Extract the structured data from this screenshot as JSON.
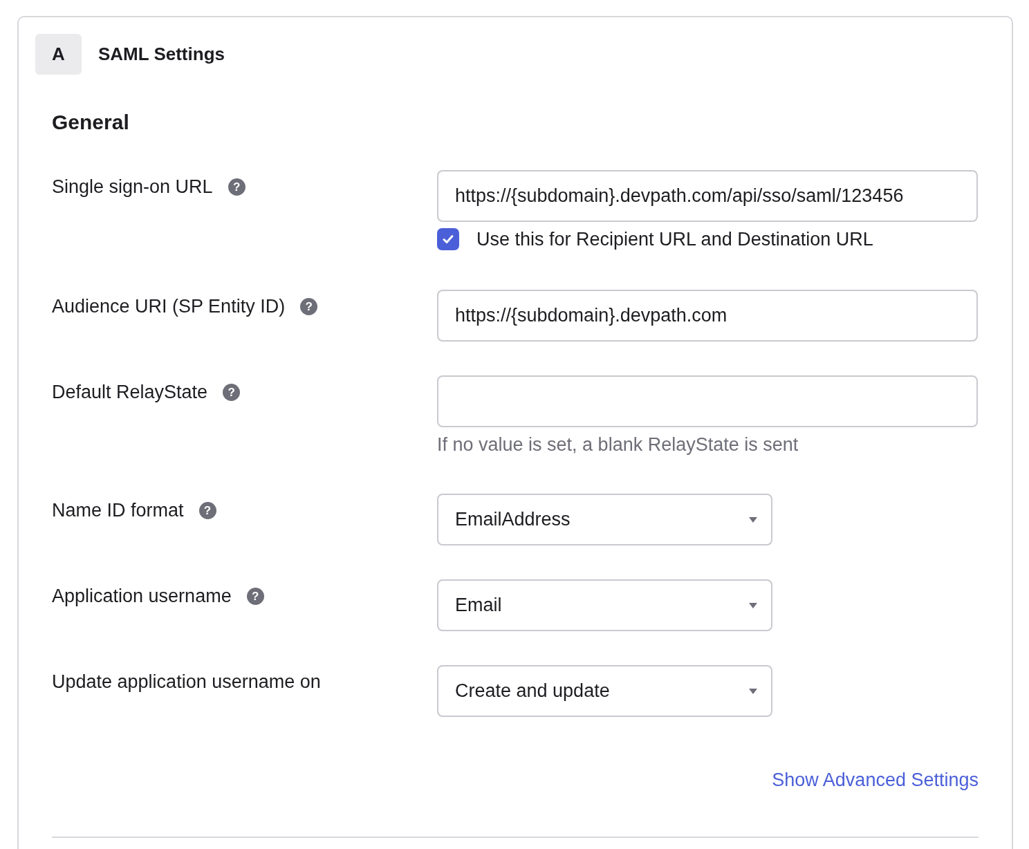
{
  "header": {
    "badge": "A",
    "title": "SAML Settings"
  },
  "section_title": "General",
  "fields": [
    {
      "kind": "text",
      "label": "Single sign-on URL",
      "help": "?",
      "value": "https://{subdomain}.devpath.com/api/sso/saml/123456",
      "checkbox": {
        "label": "Use this for Recipient URL and Destination URL",
        "checked": true
      }
    },
    {
      "kind": "text",
      "label": "Audience URI (SP Entity ID)",
      "help": "?",
      "value": "https://{subdomain}.devpath.com"
    },
    {
      "kind": "text",
      "label": "Default RelayState",
      "help": "?",
      "hint": "If no value is set, a blank RelayState is sent"
    },
    {
      "kind": "select",
      "label": "Name ID format",
      "help": "?",
      "value": "EmailAddress"
    },
    {
      "kind": "select",
      "label": "Application username",
      "help": "?",
      "value": "Email"
    },
    {
      "kind": "select",
      "label": "Update application username on",
      "value": "Create and update"
    }
  ],
  "advanced_link": "Show Advanced Settings"
}
